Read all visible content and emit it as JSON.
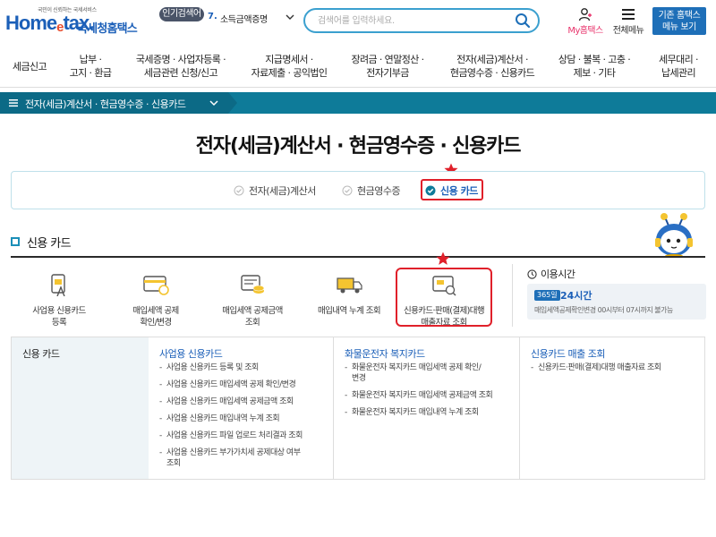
{
  "header": {
    "logo": {
      "slogan": "국민이 신뢰하는 국세서비스",
      "brand_home": "Home",
      "brand_e": "e",
      "brand_tax": "tax.",
      "brand_kr": "국세청홈택스"
    },
    "popular": {
      "badge": "인기검색어",
      "rank": "7.",
      "term": "소득금액증명"
    },
    "search": {
      "placeholder": "검색어를 입력하세요."
    },
    "my_hometax": "My홈택스",
    "all_menu": "전체메뉴",
    "legacy_btn_line1": "기존 홈택스",
    "legacy_btn_line2": "메뉴 보기"
  },
  "gnb": [
    "세금신고",
    "납부 ·\n고지 · 환급",
    "국세증명 · 사업자등록 ·\n세금관련 신청/신고",
    "지급명세서 ·\n자료제출 · 공익법인",
    "장려금 · 연말정산 ·\n전자기부금",
    "전자(세금)계산서 ·\n현금영수증 · 신용카드",
    "상담 · 불복 · 고충 ·\n제보 · 기타",
    "세무대리 ·\n납세관리"
  ],
  "breadcrumb": "전자(세금)계산서 · 현금영수증 · 신용카드",
  "page_title": "전자(세금)계산서 · 현금영수증 · 신용카드",
  "tabs": [
    {
      "label": "전자(세금)계산서",
      "active": false
    },
    {
      "label": "현금영수증",
      "active": false
    },
    {
      "label": "신용 카드",
      "active": true
    }
  ],
  "section_title": "신용 카드",
  "services": [
    {
      "label": "사업용 신용카드\n등록",
      "icon": "card-register-icon"
    },
    {
      "label": "매입세액 공제\n확인/변경",
      "icon": "card-deduction-icon"
    },
    {
      "label": "매입세액 공제금액\n조회",
      "icon": "deduction-amount-icon"
    },
    {
      "label": "매입내역 누계 조회",
      "icon": "truck-purchase-icon"
    },
    {
      "label": "신용카드·판매(결제)대행\n매출자료 조회",
      "icon": "card-sales-icon"
    }
  ],
  "service_hours": {
    "title": "이용시간",
    "days_badge": "365일",
    "hours": "24시간",
    "note": "매입세액공제확인변경 00시부터 07시까지 불가능"
  },
  "sitemap": {
    "side_title": "신용 카드",
    "columns": [
      {
        "head": "사업용 신용카드",
        "items": [
          "사업용 신용카드 등록 및 조회",
          "사업용 신용카드 매입세액 공제 확인/변경",
          "사업용 신용카드 매입세액 공제금액 조회",
          "사업용 신용카드 매입내역 누계 조회",
          "사업용 신용카드 파일 업로드 처리결과 조회",
          "사업용 신용카드 부가가치세 공제대상 여부\n조회"
        ]
      },
      {
        "head": "화물운전자 복지카드",
        "items": [
          "화물운전자 복지카드 매입세액 공제 확인/\n변경",
          "화물운전자 복지카드 매입세액 공제금액 조회",
          "화물운전자 복지카드 매입내역 누계 조회"
        ]
      },
      {
        "head": "신용카드 매출 조회",
        "items": [
          "신용카드·판매(결제)대행 매출자료 조회"
        ]
      }
    ]
  },
  "colors": {
    "brand": "#1b5fb8",
    "teal": "#0e7b99",
    "highlight": "#e0202a",
    "pink": "#e8336b"
  }
}
